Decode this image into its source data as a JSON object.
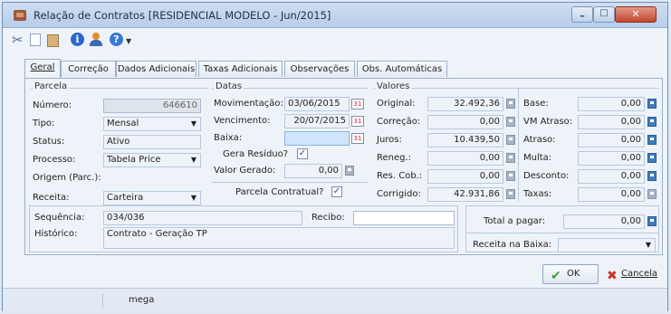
{
  "window": {
    "title": "Relação de Contratos [RESIDENCIAL MODELO - Jun/2015]"
  },
  "toolbar": {
    "icons": [
      "cut-icon",
      "copy-icon",
      "paste-icon",
      "info-icon",
      "user-icon",
      "help-icon"
    ]
  },
  "tabs": [
    {
      "label": "Geral",
      "active": true
    },
    {
      "label": "Correção"
    },
    {
      "label": "Dados Adicionais"
    },
    {
      "label": "Taxas Adicionais"
    },
    {
      "label": "Observações"
    },
    {
      "label": "Obs. Automáticas"
    }
  ],
  "parcela": {
    "title": "Parcela",
    "numero_label": "Número:",
    "numero": "646610",
    "tipo_label": "Tipo:",
    "tipo": "Mensal",
    "status_label": "Status:",
    "status": "Ativo",
    "processo_label": "Processo:",
    "processo": "Tabela Price",
    "origem_label": "Origem (Parc.):",
    "receita_label": "Receita:",
    "receita": "Carteira"
  },
  "datas": {
    "title": "Datas",
    "movimentacao_label": "Movimentação:",
    "movimentacao": "03/06/2015",
    "vencimento_label": "Vencimento:",
    "vencimento": "20/07/2015",
    "baixa_label": "Baixa:",
    "baixa": "",
    "gera_residuo_label": "Gera Resíduo?",
    "gera_residuo_checked": true,
    "valor_gerado_label": "Valor Gerado:",
    "valor_gerado": "0,00",
    "parcela_contratual_label": "Parcela Contratual?",
    "parcela_contratual_checked": true
  },
  "valores": {
    "title": "Valores",
    "original_label": "Original:",
    "original": "32.492,36",
    "correcao_label": "Correção:",
    "correcao": "0,00",
    "juros_label": "Juros:",
    "juros": "10.439,50",
    "reneg_label": "Reneg.:",
    "reneg": "0,00",
    "res_cob_label": "Res. Cob.:",
    "res_cob": "0,00",
    "corrigido_label": "Corrigido:",
    "corrigido": "42.931,86",
    "base_label": "Base:",
    "base": "0,00",
    "vm_atraso_label": "VM Atraso:",
    "vm_atraso": "0,00",
    "atraso_label": "Atraso:",
    "atraso": "0,00",
    "multa_label": "Multa:",
    "multa": "0,00",
    "desconto_label": "Desconto:",
    "desconto": "0,00",
    "taxas_label": "Taxas:",
    "taxas": "0,00"
  },
  "bottom": {
    "sequencia_label": "Sequência:",
    "sequencia": "034/036",
    "recibo_label": "Recibo:",
    "recibo": "",
    "historico_label": "Histórico:",
    "historico": "Contrato - Geração TP",
    "total_label": "Total a pagar:",
    "total": "0,00",
    "receita_baixa_label": "Receita na Baixa:",
    "receita_baixa": ""
  },
  "buttons": {
    "ok": "OK",
    "cancel": "Cancela"
  },
  "statusbar": {
    "user": "mega"
  },
  "colors": {
    "ok_check": "#3aa335",
    "cancel_x": "#d0342c",
    "calc_blue": "#3f7cc0"
  }
}
